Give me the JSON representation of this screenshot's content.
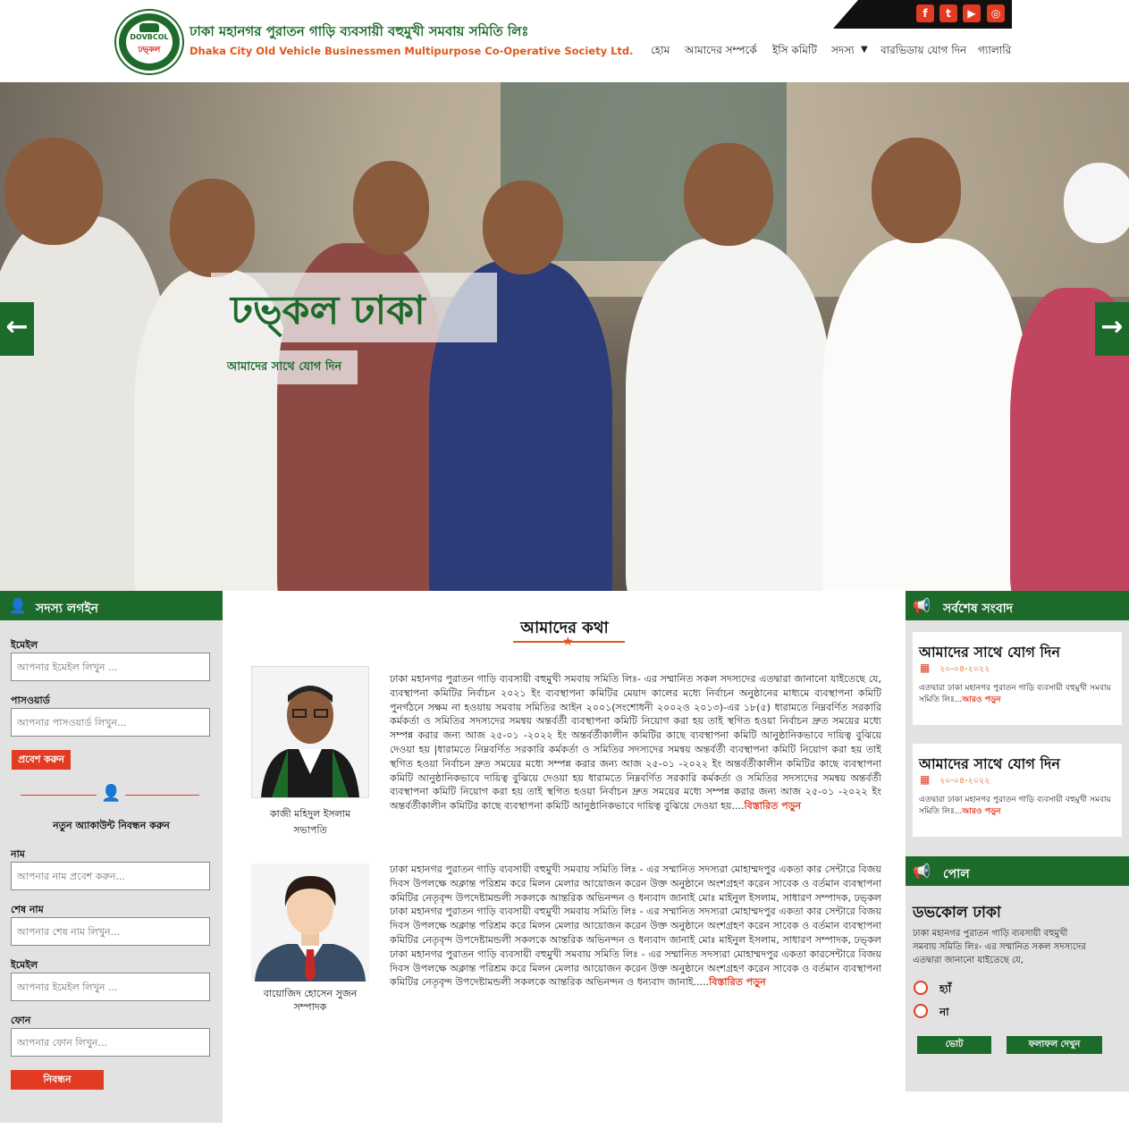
{
  "header": {
    "logo_top_text": "DOVBCOL",
    "logo_bottom_text": "ঢভ্কল",
    "brand_bn": "ঢাকা মহানগর পুরাতন গাড়ি ব্যবসায়ী বহুমুখী সমবায় সমিতি লিঃ",
    "brand_en": "Dhaka City Old Vehicle Businessmen Multipurpose Co-Operative Society Ltd.",
    "social": [
      {
        "icon": "facebook-icon",
        "glyph": "f"
      },
      {
        "icon": "twitter-icon",
        "glyph": "t"
      },
      {
        "icon": "youtube-icon",
        "glyph": "▶"
      },
      {
        "icon": "instagram-icon",
        "glyph": "◎"
      }
    ],
    "nav": [
      {
        "label": "হোম"
      },
      {
        "label": "আমাদের সম্পর্কে"
      },
      {
        "label": "ইসি কমিটি"
      },
      {
        "label": "সদস্য"
      },
      {
        "label": "বারভিডায় যোগ দিন"
      },
      {
        "label": "গ্যালারি"
      }
    ]
  },
  "hero": {
    "title": "ঢভ্কল ঢাকা",
    "button": "আমাদের সাথে যোগ দিন",
    "prev": "←",
    "next": "→"
  },
  "login": {
    "heading": "সদস্য লগইন",
    "email_label": "ইমেইল",
    "email_placeholder": "আপনার ইমেইল লিখুন ...",
    "password_label": "পাসওয়ার্ড",
    "password_placeholder": "আপনার পাসওয়ার্ড লিখুন...",
    "submit": "প্রবেশ করুন"
  },
  "register": {
    "title": "নতুন অ্যাকাউন্ট নিবন্ধন করুন",
    "name_label": "নাম",
    "name_placeholder": "আপনার নাম প্রবেশ করুন...",
    "lastname_label": "শেষ নাম",
    "lastname_placeholder": "আপনার শেষ নাম লিখুন...",
    "email_label": "ইমেইল",
    "email_placeholder": "আপনার ইমেইল লিখুন ...",
    "phone_label": "ফোন",
    "phone_placeholder": "আপনার ফোন লিখুন...",
    "submit": "নিবন্ধন"
  },
  "main": {
    "title": "আমাদের কথা",
    "messages": [
      {
        "name": "কাজী মহিদুল ইসলাম",
        "role": "সভাপতি",
        "text": "ঢাকা মহানগর পুরাতন গাড়ি ব্যবসায়ী বহুমুখী সমবায় সমিতি লিঃ- এর সম্মানিত সকল সদস্যদের এতদ্বারা জানানো যাইতেছে যে, ব্যবস্থাপনা কমিটির নির্বাচন ২০২১ ইং ব্যবস্থাপনা কমিটির মেয়াদ কালের মধ্যে নির্বাচন অনুষ্ঠানের মাধ্যমে ব্যবস্থাপনা কমিটি পুনর্গঠনে সক্ষম না হওয়ায় সমবায় সমিতির আইন ২০০১(সংশোধনী ২০০২ও ২০১৩)-এর ১৮(৫) ধারামতে নিম্নবর্ণিত সরকারি কর্মকর্তা ও সমিতির সদস্যদের সমন্বয় অন্তর্বর্তী ব্যবস্থাপনা কমিটি নিয়োগ করা হয় তাই স্থগিত হওয়া নির্বাচন দ্রুত সময়ের মধ্যে সম্পন্ন করার জন্য আজ ২৫-০১ -২০২২ ইং অন্তর্বর্তীকালীন কমিটির কাছে ব্যবস্থাপনা কমিটি আনুষ্ঠানিকভাবে দায়িত্ব বুঝিয়ে দেওয়া হয় |ধারামতে নিম্নবর্ণিত সরকারি কর্মকর্তা ও সমিতির সদস্যদের সমন্বয় অন্তর্বর্তী ব্যবস্থাপনা কমিটি নিয়োগ করা হয় তাই স্থগিত হওয়া নির্বাচন দ্রুত সময়ের মধ্যে সম্পন্ন করার জন্য আজ ২৫-০১ -২০২২ ইং অন্তর্বর্তীকালীন কমিটির কাছে ব্যবস্থাপনা কমিটি আনুষ্ঠানিকভাবে দায়িত্ব বুঝিয়ে দেওয়া হয় ধারামতে নিম্নবর্ণিত সরকারি কর্মকর্তা ও সমিতির সদস্যদের সমন্বয় অন্তর্বর্তী ব্যবস্থাপনা কমিটি নিয়োগ করা হয় তাই স্থগিত হওয়া নির্বাচন দ্রুত সময়ের মধ্যে সম্পন্ন করার জন্য আজ ২৫-০১ -২০২২ ইং অন্তর্বর্তীকালীন কমিটির কাছে ব্যবস্থাপনা কমিটি আনুষ্ঠানিকভাবে দায়িত্ব বুঝিয়ে দেওয়া হয়....",
        "more": "বিস্তারিত পড়ুন"
      },
      {
        "name": "বায়োজিদ হোসেন সুজন",
        "role": "সম্পাদক",
        "text": "ঢাকা মহানগর পুরাতন গাড়ি ব্যবসায়ী বহুমুখী সমবায় সমিতি লিঃ - এর সম্মানিত সদস্যরা মোহাম্মদপুর একতা কার সেন্টারে বিজয় দিবস উপলক্ষে অক্লান্ত পরিশ্রম করে মিলন মেলার আয়োজন করেন উক্ত অনুষ্ঠানে অংশগ্রহণ করেন সাবেক ও বর্তমান ব্যবস্থাপনা কমিটির নেতৃবৃন্দ উপদেষ্টামন্ডলী সকলকে আন্তরিক অভিনন্দন ও ধন্যবাদ জানাই মোঃ মাইনুল ইসলাম, সাধারণ সম্পাদক, ঢভ্কল ঢাকা মহানগর পুরাতন গাড়ি ব্যবসায়ী বহুমুখী সমবায় সমিতি লিঃ - এর সম্মানিত সদস্যরা মোহাম্মদপুর একতা কার সেন্টারে বিজয় দিবস উপলক্ষে অক্লান্ত পরিশ্রম করে মিলন মেলার আয়োজন করেন উক্ত অনুষ্ঠানে অংশগ্রহণ করেন সাবেক ও বর্তমান ব্যবস্থাপনা কমিটির নেতৃবৃন্দ উপদেষ্টামন্ডলী সকলকে আন্তরিক অভিনন্দন ও ধন্যবাদ জানাই মোঃ মাইনুল ইসলাম, সাধারণ সম্পাদক, ঢভ্কল ঢাকা মহানগর পুরাতন গাড়ি ব্যবসায়ী বহুমুখী সমবায় সমিতি লিঃ - এর সম্মানিত সদস্যরা মোহাম্মদপুর একতা কারসেন্টারে বিজয় দিবস উপলক্ষে অক্লান্ত পরিশ্রম করে মিলন মেলার আয়োজন করেন উক্ত অনুষ্ঠানে অংশগ্রহণ করেন সাবেক ও বর্তমান ব্যবস্থাপনা কমিটির নেতৃবৃন্দ উপদেষ্টামন্ডলী সকলকে আন্তরিক অভিনন্দন ও ধন্যবাদ জানাই.....",
        "more": "বিস্তারিত পড়ুন"
      }
    ]
  },
  "news": {
    "heading": "সর্বশেষ সংবাদ",
    "items": [
      {
        "title": "আমাদের সাথে যোগ দিন",
        "date": "২০-০৪-২০২২",
        "body": "এতদ্বারা ঢাকা মহানগর পুরাতন গাড়ি ব্যবসায়ী বহুমুখী সমবায় সমিতি লিঃ...",
        "more": "আরও পড়ুন"
      },
      {
        "title": "আমাদের সাথে যোগ দিন",
        "date": "২০-০৪-২০২২",
        "body": "এতদ্বারা ঢাকা মহানগর পুরাতন গাড়ি ব্যবসায়ী বহুমুখী সমবায় সমিতি লিঃ...",
        "more": "আরও পড়ুন"
      }
    ]
  },
  "poll": {
    "heading": "পোল",
    "title": "ডভকোল ঢাকা",
    "description": "ঢাকা মহানগর পুরাতন গাড়ি ব্যবসায়ী বহুমুখী সমবায় সমিতি লিঃ- এর সম্মানিত সকল সদস্যদের এতদ্বারা জানানো যাইতেছে যে,",
    "options": [
      "হ্যাঁ",
      "না"
    ],
    "vote": "ভোট",
    "results": "ফলাফল দেখুন"
  },
  "colors": {
    "brand_green": "#1d6b2a",
    "accent_red": "#e23b22",
    "accent_orange": "#e0581c",
    "sidebar_gray": "#e2e2e2"
  }
}
